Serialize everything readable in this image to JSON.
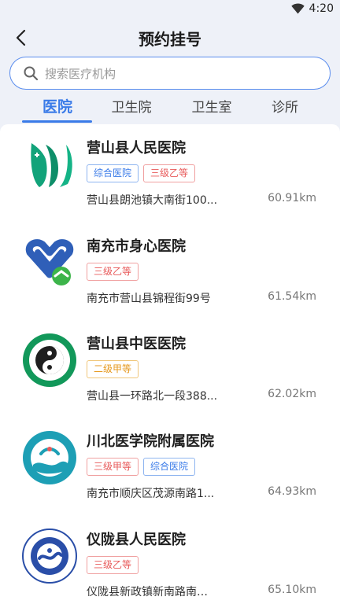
{
  "status": {
    "time": "4:20"
  },
  "header": {
    "title": "预约挂号",
    "back_icon": "chevron-left-icon"
  },
  "search": {
    "placeholder": "搜索医疗机构",
    "value": ""
  },
  "tabs": [
    {
      "label": "医院",
      "active": true
    },
    {
      "label": "卫生院",
      "active": false
    },
    {
      "label": "卫生室",
      "active": false
    },
    {
      "label": "诊所",
      "active": false
    }
  ],
  "colors": {
    "accent": "#3a7be8",
    "tag_red": "#e85a5a",
    "tag_blue": "#3a7be8",
    "tag_orange": "#e69a20"
  },
  "hospitals": [
    {
      "name": "营山县人民医院",
      "tags": [
        {
          "text": "综合医院",
          "color": "blue"
        },
        {
          "text": "三级乙等",
          "color": "red"
        }
      ],
      "address": "营山县朗池镇大南街100...",
      "distance": "60.91km",
      "logo": "green-leaf-logo"
    },
    {
      "name": "南充市身心医院",
      "tags": [
        {
          "text": "三级乙等",
          "color": "red"
        }
      ],
      "address": "南充市营山县锦程街99号",
      "distance": "61.54km",
      "logo": "blue-heart-logo"
    },
    {
      "name": "营山县中医医院",
      "tags": [
        {
          "text": "二级甲等",
          "color": "orange"
        }
      ],
      "address": "营山县一环路北一段388...",
      "distance": "62.02km",
      "logo": "yin-yang-logo"
    },
    {
      "name": "川北医学院附属医院",
      "tags": [
        {
          "text": "三级甲等",
          "color": "red"
        },
        {
          "text": "综合医院",
          "color": "blue"
        }
      ],
      "address": "南充市顺庆区茂源南路1...",
      "distance": "64.93km",
      "logo": "teal-seal-logo"
    },
    {
      "name": "仪陇县人民医院",
      "tags": [
        {
          "text": "三级乙等",
          "color": "red"
        }
      ],
      "address": "仪陇县新政镇新南路南…",
      "distance": "65.10km",
      "logo": "blue-seal-logo"
    }
  ]
}
